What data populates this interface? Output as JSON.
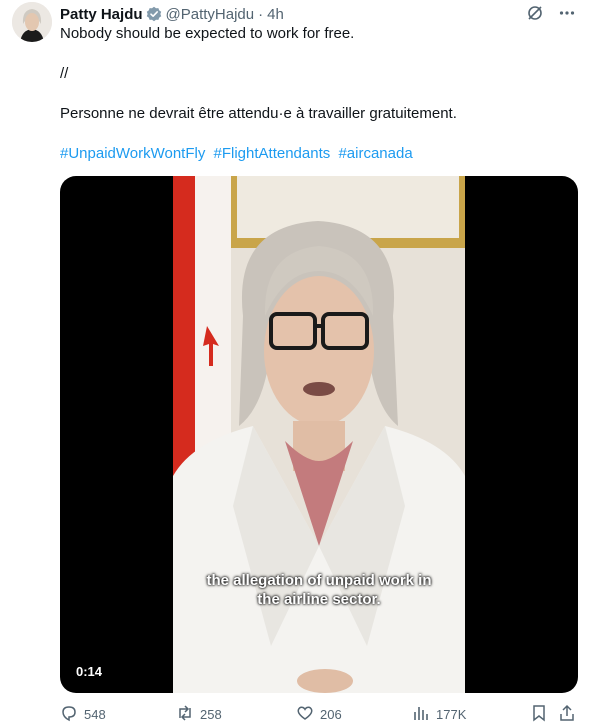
{
  "author": {
    "name": "Patty Hajdu",
    "handle": "@PattyHajdu",
    "separator": "·",
    "time": "4h"
  },
  "tweet": {
    "line1": "Nobody should be expected to work for free.",
    "line2": "//",
    "line3": "Personne ne devrait être attendu·e à travailler gratuitement.",
    "hashtags": [
      "#UnpaidWorkWontFly",
      "#FlightAttendants",
      "#aircanada"
    ]
  },
  "video": {
    "subtitle_line1": "the allegation of unpaid work in",
    "subtitle_line2": "the airline sector.",
    "duration": "0:14"
  },
  "actions": {
    "replies": "548",
    "reposts": "258",
    "likes": "206",
    "views": "177K"
  },
  "icons": {
    "top": [
      "grok-icon",
      "more-icon"
    ],
    "actions": [
      "reply-icon",
      "repost-icon",
      "like-icon",
      "views-icon",
      "bookmark-icon",
      "share-icon"
    ]
  },
  "colors": {
    "accent": "#1d9bf0",
    "muted": "#536471",
    "text": "#0f1419"
  }
}
